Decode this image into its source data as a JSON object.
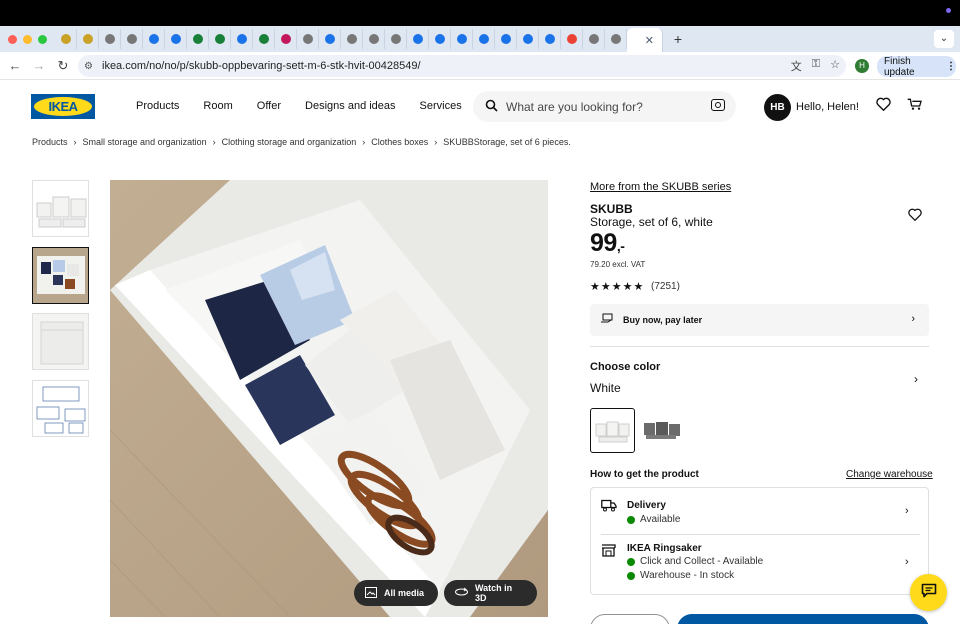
{
  "browser": {
    "url": "ikea.com/no/no/p/skubb-oppbevaring-sett-m-6-stk-hvit-00428549/",
    "profile_initial": "H",
    "finish_update_label": "Finish update",
    "tab_icons": [
      "star-icon",
      "star-icon",
      "chrome-icon",
      "chrome-icon",
      "cube-icon",
      "docs-icon",
      "sheets-icon",
      "sheets-icon",
      "cube-icon",
      "sheets-icon",
      "target-icon",
      "chrome-icon",
      "download-icon",
      "chrome-icon",
      "chrome-icon",
      "chrome-icon",
      "window-icon",
      "t-icon",
      "t-icon",
      "t-icon",
      "t-icon",
      "cube-icon",
      "puzzle-icon",
      "google-icon",
      "chrome-icon",
      "chrome-icon",
      "active-tab"
    ]
  },
  "header": {
    "logo_text": "IKEA",
    "nav": [
      "Products",
      "Room",
      "Offer",
      "Designs and ideas",
      "Services"
    ],
    "search_placeholder": "What are you looking for?",
    "avatar_initials": "HB",
    "greeting": "Hello, Helen!"
  },
  "breadcrumb": [
    "Products",
    "Small storage and organization",
    "Clothing storage and organization",
    "Clothes boxes",
    "SKUBBStorage, set of 6 pieces."
  ],
  "media": {
    "all_media_label": "All media",
    "watch_3d_label": "Watch in 3D"
  },
  "product": {
    "series_link": "More from the SKUBB series",
    "name": "SKUBB",
    "description": "Storage, set of 6, white",
    "price_main": "99",
    "price_suffix": ",-",
    "price_excl_vat": "79.20 excl. VAT",
    "rating_stars": "★★★★★",
    "rating_value": 5,
    "review_count": "(7251)",
    "bnpl_label": "Buy now, pay later"
  },
  "color": {
    "heading": "Choose color",
    "selected": "White",
    "options": [
      "White",
      "Dark grey"
    ]
  },
  "availability": {
    "heading": "How to get the product",
    "change_warehouse": "Change warehouse",
    "delivery_title": "Delivery",
    "delivery_status": "Available",
    "store_title": "IKEA Ringsaker",
    "store_status_1": "Click and Collect - Available",
    "store_status_2": "Warehouse - In stock"
  },
  "colors": {
    "ikea_blue": "#0058a3",
    "ikea_yellow": "#ffda1a",
    "available_green": "#0a8a00"
  }
}
